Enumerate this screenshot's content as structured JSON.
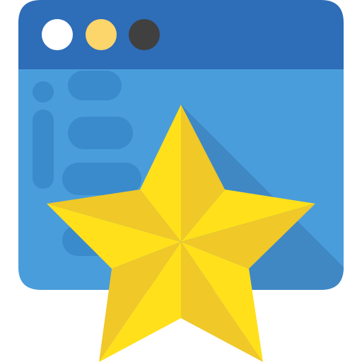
{
  "icon": {
    "name": "favorite-webpage-icon",
    "subject": "browser-window-with-star"
  },
  "window": {
    "titlebar_color": "#2E6DB8",
    "body_color": "#4A9DDB",
    "shadow_color": "#3F88C4",
    "content_mark_color": "#3A8BCB",
    "buttons": [
      {
        "name": "window-button-white",
        "color": "#FFFFFF"
      },
      {
        "name": "window-button-yellow",
        "color": "#FCD56B"
      },
      {
        "name": "window-button-dark",
        "color": "#404040"
      }
    ]
  },
  "star": {
    "light_color": "#FFE01B",
    "dark_color": "#F0C828"
  }
}
